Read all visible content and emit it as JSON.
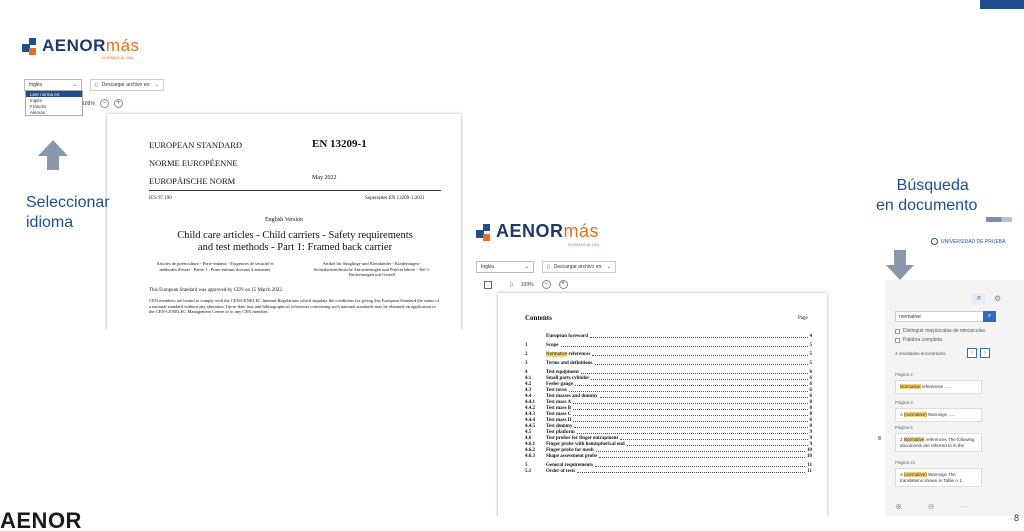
{
  "brand": {
    "name": "AENOR",
    "suffix": "más",
    "sub": "NORMAS AL DÍA"
  },
  "user": {
    "label": "UNIVERSIDAD DE PRUEBA"
  },
  "left_shot": {
    "language_select": {
      "value": "Inglés",
      "options": [
        "Leer norma en:",
        "Inglés",
        "Francés",
        "Alemán"
      ]
    },
    "download_label": "Descargar archivo en:",
    "zoom": "109%",
    "doc": {
      "std_en": "EUROPEAN STANDARD",
      "std_fr": "NORME EUROPÉENNE",
      "std_de": "EUROPÄISCHE NORM",
      "code": "EN 13209-1",
      "date": "May 2022",
      "ics": "ICS 97.190",
      "supersedes": "Supersedes EN 13209-1:2021",
      "version": "English Version",
      "title_line1": "Child care articles - Child carriers - Safety requirements",
      "title_line2": "and test methods - Part 1: Framed back carrier",
      "col_fr": "Articles de puériculture - Porte-enfants - Exigences de sécurité et méthodes d'essai - Partie 1 : Porte-enfants dorsaux à armature",
      "col_de": "Artikel für Säuglinge und Kleinkinder - Kindertragen - Sicherheitstechnische Anforderungen und Prüfverfahren - Teil 1: Rückentragen mit Gestell",
      "approved": "This European Standard was approved by CEN on 15 March 2022.",
      "cen_text": "CEN members are bound to comply with the CEN/CENELEC Internal Regulations which stipulate the conditions for giving this European Standard the status of a national standard without any alteration. Up-to-date lists and bibliographical references concerning such national standards may be obtained on application to the CEN-CENELEC Management Centre or to any CEN member."
    }
  },
  "annotations": {
    "select_language": [
      "Seleccionar",
      "idioma"
    ],
    "search_document": [
      "Búsqueda",
      "en documento"
    ]
  },
  "right_shot": {
    "language_select": {
      "value": "Inglés"
    },
    "download_label": "Descargar archivo en:",
    "zoom": "109%",
    "doc": {
      "contents": "Contents",
      "page": "Page",
      "toc": [
        {
          "num": "",
          "text": "European foreword",
          "page": "4",
          "gap": false
        },
        {
          "num": "1",
          "text": "Scope",
          "page": "5",
          "gap": true
        },
        {
          "num": "2",
          "text": "Normative",
          "rest": " references",
          "page": "5",
          "gap": true,
          "hl": true
        },
        {
          "num": "3",
          "text": "Terms and definitions",
          "page": "5",
          "gap": true
        },
        {
          "num": "4",
          "text": "Test equipment",
          "page": "6",
          "gap": true
        },
        {
          "num": "4.1",
          "text": "Small parts cylinder",
          "page": "6",
          "gap": false
        },
        {
          "num": "4.2",
          "text": "Feeler gauge",
          "page": "6",
          "gap": false
        },
        {
          "num": "4.3",
          "text": "Test torso",
          "page": "6",
          "gap": false
        },
        {
          "num": "4.4",
          "text": "Test masses and dummy",
          "page": "8",
          "gap": false
        },
        {
          "num": "4.4.1",
          "text": "Test mass A",
          "page": "8",
          "gap": false
        },
        {
          "num": "4.4.2",
          "text": "Test mass B",
          "page": "8",
          "gap": false
        },
        {
          "num": "4.4.3",
          "text": "Test mass C",
          "page": "8",
          "gap": false
        },
        {
          "num": "4.4.4",
          "text": "Test mass D",
          "page": "8",
          "gap": false
        },
        {
          "num": "4.4.5",
          "text": "Test dummy",
          "page": "8",
          "gap": false
        },
        {
          "num": "4.5",
          "text": "Test platform",
          "page": "9",
          "gap": false
        },
        {
          "num": "4.6",
          "text": "Test probes for finger entrapment",
          "page": "9",
          "gap": false
        },
        {
          "num": "4.6.1",
          "text": "Finger probe with hemispherical end",
          "page": "9",
          "gap": false
        },
        {
          "num": "4.6.2",
          "text": "Finger probe for mesh",
          "page": "10",
          "gap": false
        },
        {
          "num": "4.6.3",
          "text": "Shape assessment probe",
          "page": "10",
          "gap": false
        },
        {
          "num": "5",
          "text": "General requirements",
          "page": "11",
          "gap": true
        },
        {
          "num": "5.1",
          "text": "Order of tests",
          "page": "11",
          "gap": false
        }
      ]
    },
    "search_panel": {
      "query": "normative",
      "option_case": "Distinguir mayúsculas de minúsculas",
      "option_whole": "Palabra completa",
      "results_count": "4 resultados encontrados",
      "results": [
        {
          "page": "Página 2",
          "pre": "",
          "match": "Normative",
          "post": " references ......"
        },
        {
          "page": "Página 3",
          "pre": "A ",
          "match": "(normative)",
          "post": " Warnings ......"
        },
        {
          "page": "Página 5",
          "pre": "2 ",
          "match": "Normative",
          "post": " references The following documents are referred to in the"
        },
        {
          "page": "Página 21",
          "pre": "A ",
          "match": "(normative)",
          "post": " Warnings The translations shown in Table A.1"
        }
      ]
    }
  },
  "footer": {
    "logo": "AENOR",
    "slide_number": "8"
  }
}
